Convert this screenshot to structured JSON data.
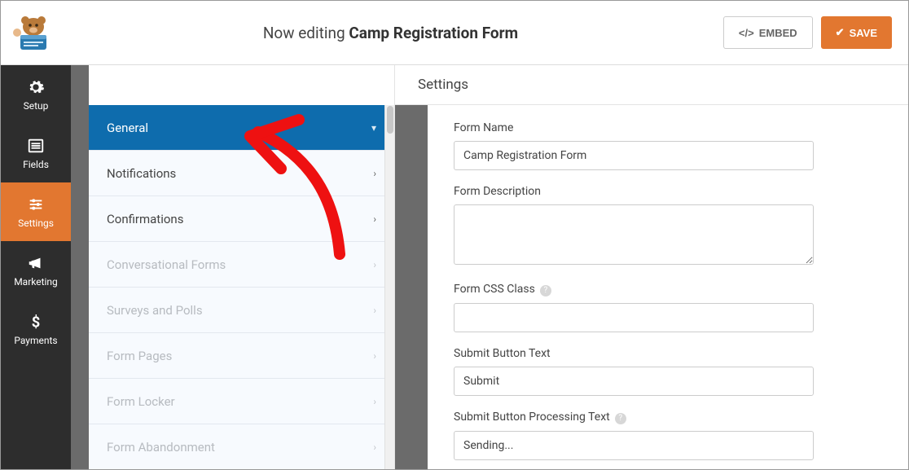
{
  "header": {
    "editing_prefix": "Now editing ",
    "editing_title": "Camp Registration Form",
    "embed_label": "EMBED",
    "save_label": "SAVE"
  },
  "rail": {
    "setup": "Setup",
    "fields": "Fields",
    "settings": "Settings",
    "marketing": "Marketing",
    "payments": "Payments"
  },
  "sidebar": {
    "general": "General",
    "notifications": "Notifications",
    "confirmations": "Confirmations",
    "conversational": "Conversational Forms",
    "surveys": "Surveys and Polls",
    "pages": "Form Pages",
    "locker": "Form Locker",
    "abandonment": "Form Abandonment"
  },
  "panel": {
    "title": "Settings",
    "form_name_label": "Form Name",
    "form_name_value": "Camp Registration Form",
    "form_description_label": "Form Description",
    "form_description_value": "",
    "css_class_label": "Form CSS Class",
    "css_class_value": "",
    "submit_text_label": "Submit Button Text",
    "submit_text_value": "Submit",
    "submit_processing_label": "Submit Button Processing Text",
    "submit_processing_value": "Sending..."
  }
}
